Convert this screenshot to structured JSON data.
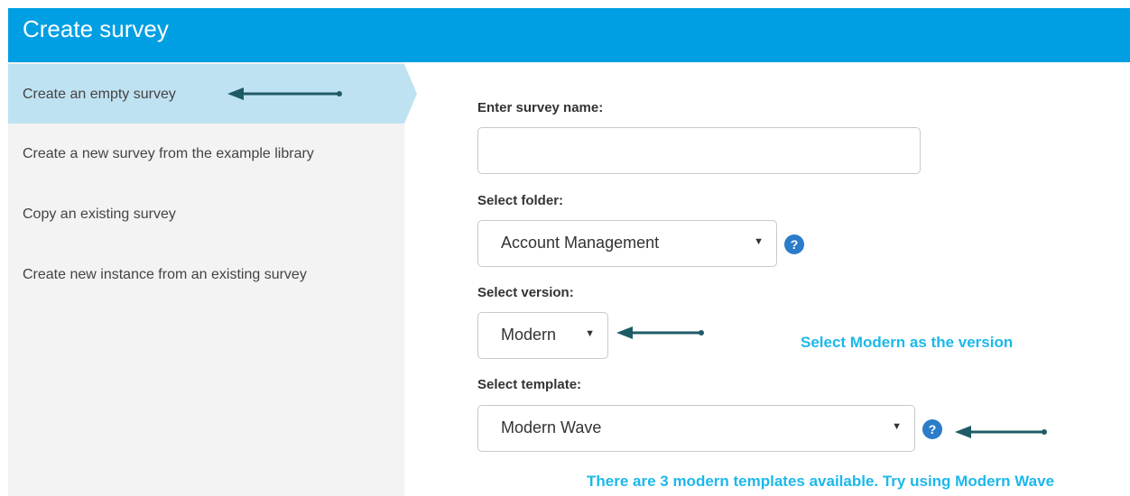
{
  "header": {
    "title": "Create survey"
  },
  "sidebar": {
    "items": [
      {
        "label": "Create an empty survey",
        "active": true
      },
      {
        "label": "Create a new survey from the example library"
      },
      {
        "label": "Copy an existing survey"
      },
      {
        "label": "Create new instance from an existing survey"
      }
    ]
  },
  "form": {
    "name_label": "Enter survey name:",
    "name_value": "",
    "folder_label": "Select folder:",
    "folder_value": "Account Management",
    "version_label": "Select version:",
    "version_value": "Modern",
    "template_label": "Select template:",
    "template_value": "Modern Wave",
    "help_glyph": "?",
    "caret_glyph": "▼"
  },
  "annotations": {
    "version_note": "Select Modern as the version",
    "template_note": "There are 3 modern templates available. Try using Modern Wave",
    "color": "#1cb8ea",
    "arrow_color": "#1f5b66"
  },
  "colors": {
    "header_bg": "#009fe3",
    "sidebar_bg": "#f3f3f3",
    "active_bg": "#bfe2f2",
    "help_bg": "#2b7cc9"
  }
}
